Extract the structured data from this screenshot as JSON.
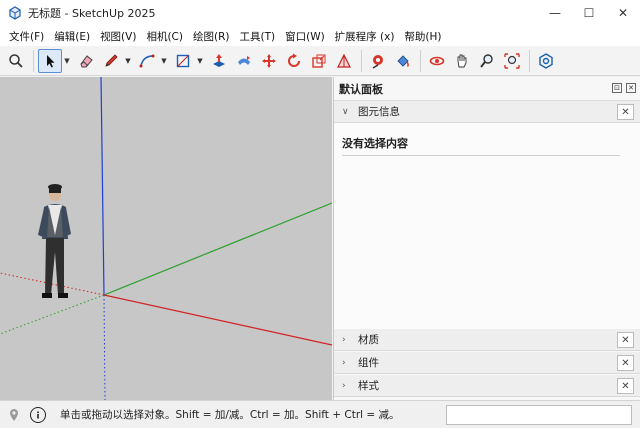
{
  "window": {
    "title": "无标题 - SketchUp 2025",
    "minimize_glyph": "—",
    "maximize_glyph": "☐",
    "close_glyph": "✕"
  },
  "menu": [
    {
      "label": "文件(F)"
    },
    {
      "label": "编辑(E)"
    },
    {
      "label": "视图(V)"
    },
    {
      "label": "相机(C)"
    },
    {
      "label": "绘图(R)"
    },
    {
      "label": "工具(T)"
    },
    {
      "label": "窗口(W)"
    },
    {
      "label": "扩展程序 (x)"
    },
    {
      "label": "帮助(H)"
    }
  ],
  "toolbar": {
    "active_tool": "select-tool",
    "tools": [
      "search-icon",
      "select-arrow-icon",
      "eraser-icon",
      "pencil-icon",
      "arc-icon",
      "rectangle-icon",
      "push-pull-icon",
      "follow-me-icon",
      "move-icon",
      "rotate-icon",
      "scale-icon",
      "section-icon",
      "tape-measure-icon",
      "paint-bucket-icon",
      "orbit-icon",
      "pan-icon",
      "zoom-icon",
      "zoom-extents-icon",
      "extension-warehouse-icon"
    ]
  },
  "colors": {
    "sky": "#c7c7c7",
    "ground": "#c7c7c7",
    "axis_blue": "#1f3fd0",
    "axis_green": "#2aa02a",
    "axis_red": "#d42020",
    "accent": "#1a5fb4"
  },
  "tray": {
    "title": "默认面板",
    "pin_glyph": "⊡",
    "close_glyph": "✕",
    "entity_info": {
      "label": "图元信息",
      "expanded": true,
      "message": "没有选择内容"
    },
    "sections": [
      {
        "label": "材质",
        "expanded": false
      },
      {
        "label": "组件",
        "expanded": false
      },
      {
        "label": "样式",
        "expanded": false
      }
    ],
    "section_close_glyph": "✕",
    "chev_expanded": "∨",
    "chev_collapsed": "›"
  },
  "statusbar": {
    "hint": "单击或拖动以选择对象。Shift = 加/减。Ctrl = 加。Shift + Ctrl = 减。",
    "measurements_value": ""
  }
}
